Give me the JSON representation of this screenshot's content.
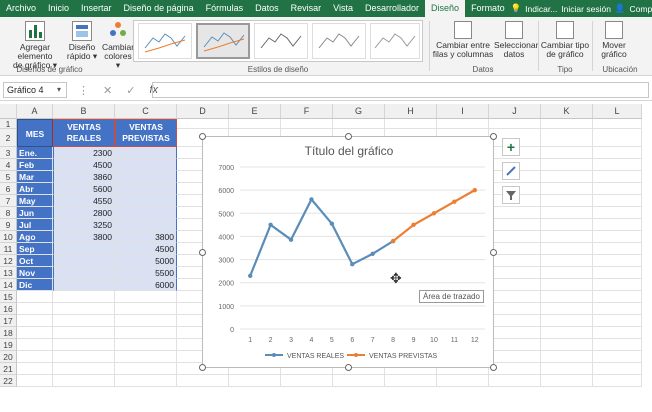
{
  "tabs": [
    "Archivo",
    "Inicio",
    "Insertar",
    "Diseño de página",
    "Fórmulas",
    "Datos",
    "Revisar",
    "Vista",
    "Desarrollador",
    "Diseño",
    "Formato"
  ],
  "active_tab": "Diseño",
  "tell_me": "Indicar...",
  "signin": "Iniciar sesión",
  "share": "Compartir",
  "ribbon": {
    "add_element": "Agregar elemento\nde gráfico ▾",
    "quick_layout": "Diseño\nrápido ▾",
    "change_colors": "Cambiar\ncolores ▾",
    "group_layouts": "Diseños de gráfico",
    "group_styles": "Estilos de diseño",
    "switch_rows": "Cambiar entre\nfilas y columnas",
    "select_data": "Seleccionar\ndatos",
    "group_data": "Datos",
    "change_type": "Cambiar tipo\nde gráfico",
    "group_type": "Tipo",
    "move_chart": "Mover\ngráfico",
    "group_location": "Ubicación"
  },
  "name_box": "Gráfico 4",
  "columns": [
    "A",
    "B",
    "C",
    "D",
    "E",
    "F",
    "G",
    "H",
    "I",
    "J",
    "K",
    "L"
  ],
  "rows": [
    "1",
    "2",
    "3",
    "4",
    "5",
    "6",
    "7",
    "8",
    "9",
    "10",
    "11",
    "12",
    "13",
    "14",
    "15",
    "16",
    "17",
    "18",
    "19",
    "20",
    "21",
    "22"
  ],
  "table": {
    "header_mes": "MES",
    "header_reales": "VENTAS\nREALES",
    "header_previstas": "VENTAS\nPREVISTAS",
    "months": [
      "Ene.",
      "Feb",
      "Mar",
      "Abr",
      "May",
      "Jun",
      "Jul",
      "Ago",
      "Sep",
      "Oct",
      "Nov",
      "Dic"
    ],
    "reales": [
      "2300",
      "4500",
      "3860",
      "5600",
      "4550",
      "2800",
      "3250",
      "3800",
      "",
      "",
      "",
      ""
    ],
    "previstas": [
      "",
      "",
      "",
      "",
      "",
      "",
      "",
      "3800",
      "4500",
      "5000",
      "5500",
      "6000"
    ]
  },
  "chart_data": {
    "type": "line",
    "title": "Título del gráfico",
    "x": [
      1,
      2,
      3,
      4,
      5,
      6,
      7,
      8,
      9,
      10,
      11,
      12
    ],
    "x_ticks": [
      "1",
      "2",
      "3",
      "4",
      "5",
      "6",
      "7",
      "8",
      "9",
      "10",
      "11",
      "12"
    ],
    "y_ticks": [
      "0",
      "1000",
      "2000",
      "3000",
      "4000",
      "5000",
      "6000",
      "7000"
    ],
    "ylim": [
      0,
      7000
    ],
    "grid": true,
    "legend_position": "bottom",
    "series": [
      {
        "name": "VENTAS REALES",
        "color": "#5b8db8",
        "values": [
          2300,
          4500,
          3860,
          5600,
          4550,
          2800,
          3250,
          3800,
          null,
          null,
          null,
          null
        ]
      },
      {
        "name": "VENTAS PREVISTAS",
        "color": "#ed7d31",
        "values": [
          null,
          null,
          null,
          null,
          null,
          null,
          null,
          3800,
          4500,
          5000,
          5500,
          6000
        ]
      }
    ]
  },
  "tooltip": "Área de trazado"
}
